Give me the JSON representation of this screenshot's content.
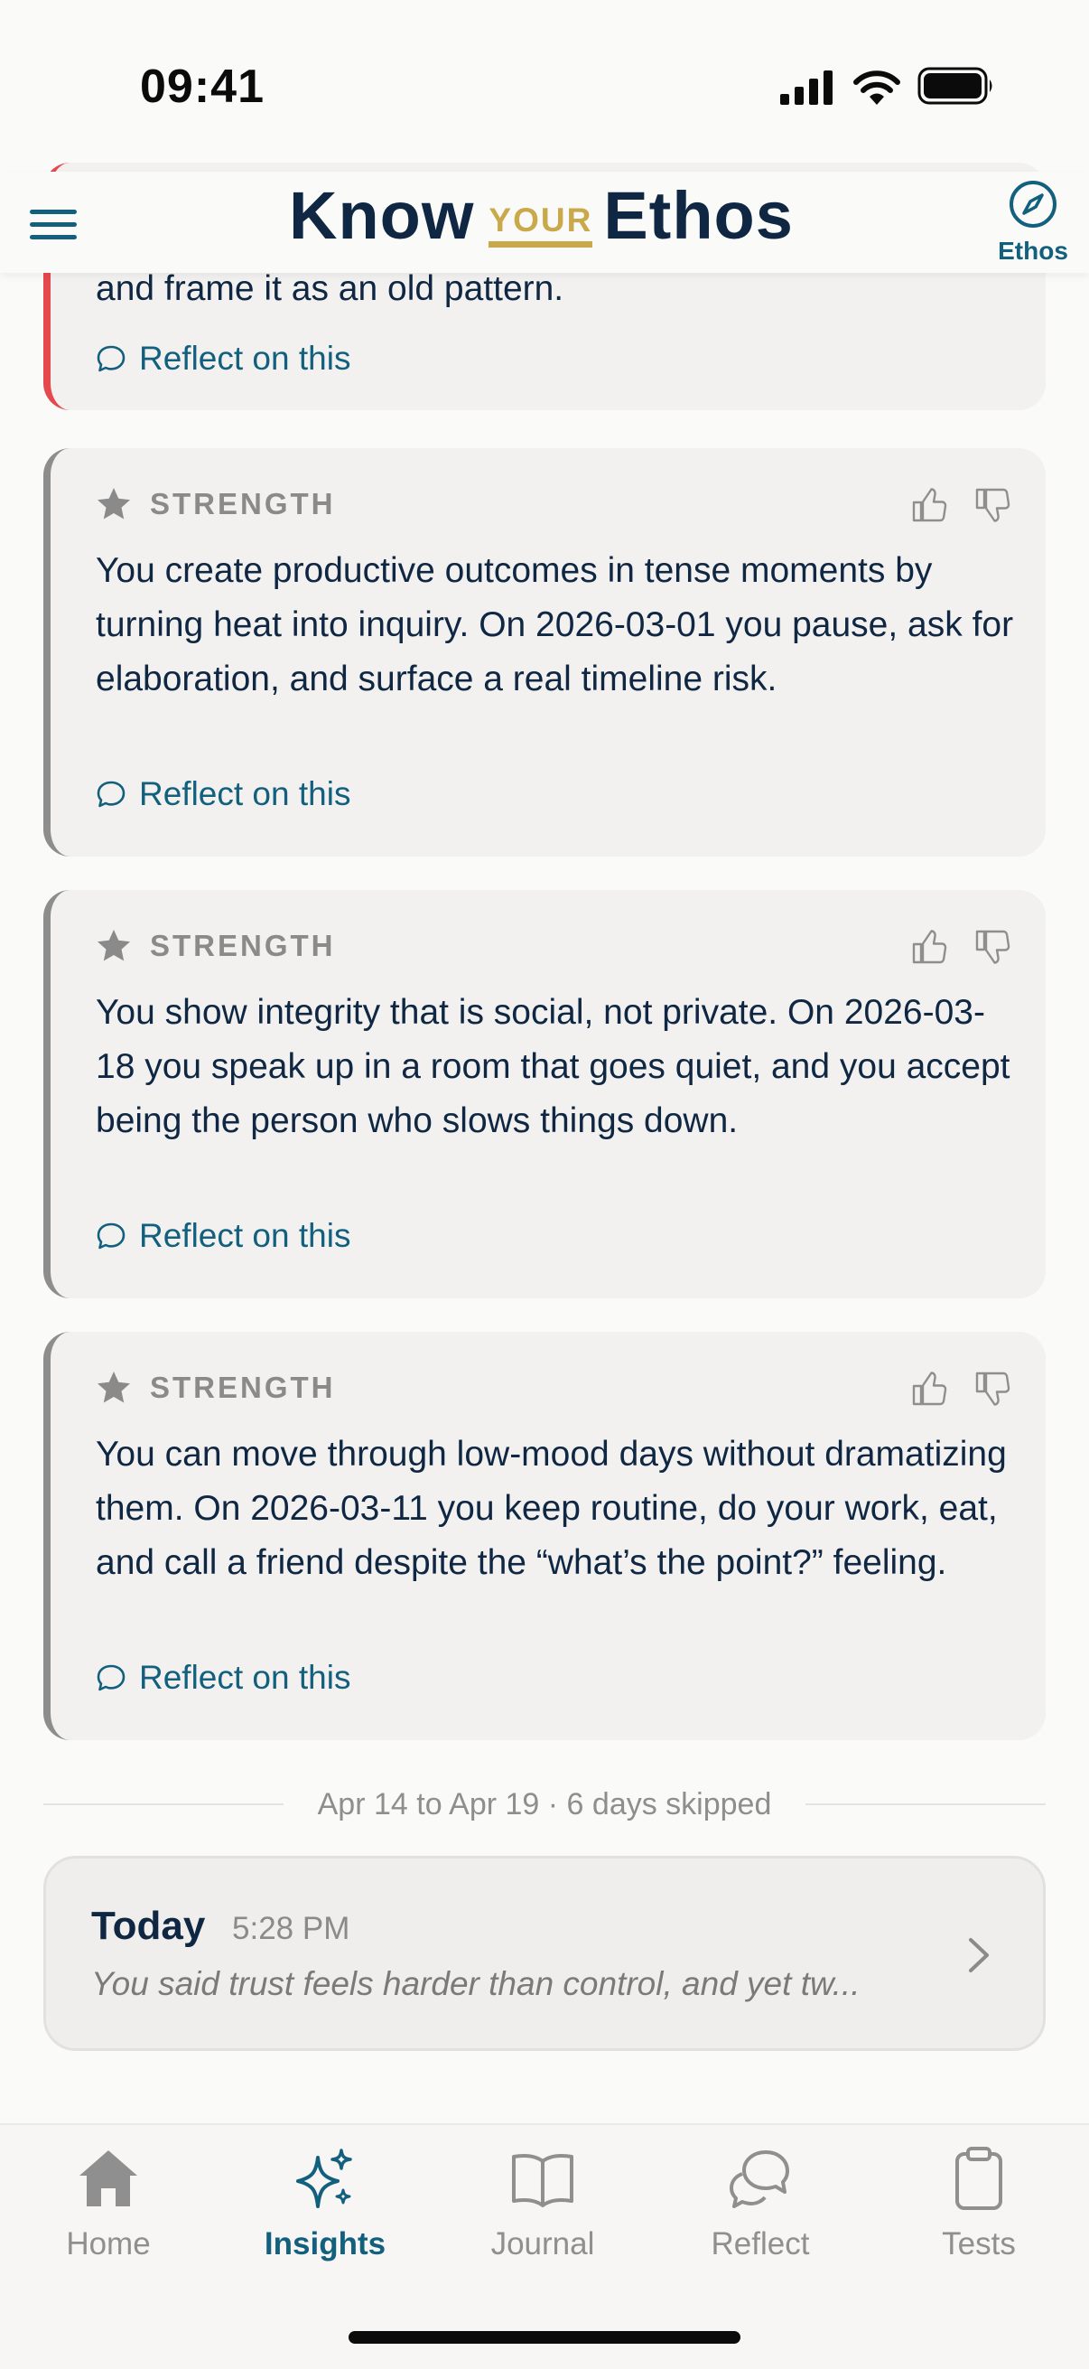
{
  "status_bar": {
    "time": "09:41"
  },
  "header": {
    "logo_know": "Know",
    "logo_your": "YOUR",
    "logo_ethos": "Ethos",
    "ethos_button_label": "Ethos"
  },
  "partial_card": {
    "text": "and frame it as an old pattern.",
    "reflect_label": "Reflect on this"
  },
  "cards": [
    {
      "label": "STRENGTH",
      "text": "You create productive outcomes in tense moments by turning heat into inquiry. On 2026-03-01 you pause, ask for elaboration, and surface a real timeline risk.",
      "reflect_label": "Reflect on this"
    },
    {
      "label": "STRENGTH",
      "text": "You show integrity that is social, not private. On 2026-03-18 you speak up in a room that goes quiet, and you accept being the person who slows things down.",
      "reflect_label": "Reflect on this"
    },
    {
      "label": "STRENGTH",
      "text": "You can move through low-mood days without dramatizing them. On 2026-03-11 you keep routine, do your work, eat, and call a friend despite the “what’s the point?” feeling.",
      "reflect_label": "Reflect on this"
    }
  ],
  "divider": {
    "text": "Apr 14 to Apr 19 · 6 days skipped"
  },
  "today_card": {
    "title": "Today",
    "time": "5:28 PM",
    "snippet": "You said trust feels harder than control, and yet tw..."
  },
  "bottom_nav": {
    "items": [
      {
        "label": "Home",
        "icon": "home-icon"
      },
      {
        "label": "Insights",
        "icon": "sparkles-icon",
        "active": true
      },
      {
        "label": "Journal",
        "icon": "book-icon"
      },
      {
        "label": "Reflect",
        "icon": "chat-bubbles-icon"
      },
      {
        "label": "Tests",
        "icon": "clipboard-icon"
      }
    ]
  },
  "colors": {
    "accent": "#12607E",
    "navy": "#0F2742",
    "gold": "#C9A94A",
    "alert_red": "#E5484D"
  }
}
